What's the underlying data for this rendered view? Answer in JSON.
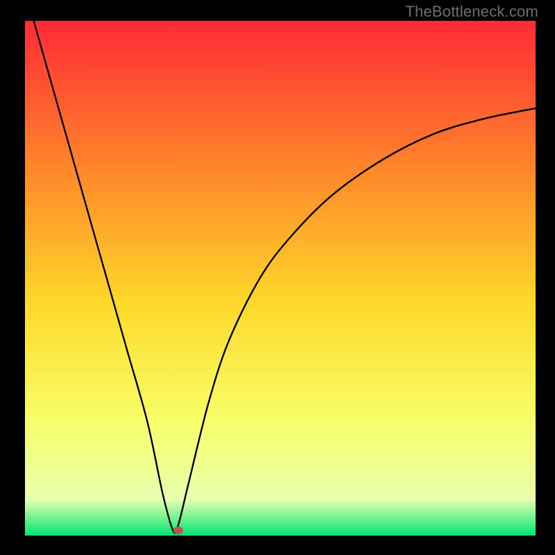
{
  "watermark": "TheBottleneck.com",
  "chart_data": {
    "type": "line",
    "title": "",
    "xlabel": "",
    "ylabel": "",
    "xlim": [
      0,
      100
    ],
    "ylim": [
      0,
      100
    ],
    "gradient_colors": {
      "top": "#ff2a36",
      "upper_mid": "#ff8a2a",
      "mid": "#ffd92a",
      "lower_mid": "#f7ff6a",
      "near_bottom": "#e8ffb0",
      "bottom": "#00e671"
    },
    "series": [
      {
        "name": "bottleneck-curve",
        "comment": "V-shaped curve; y is 'distance from optimal' style metric, minimum near x≈29",
        "x": [
          0,
          4,
          8,
          12,
          16,
          20,
          24,
          27,
          29,
          30,
          32,
          36,
          40,
          46,
          52,
          60,
          70,
          80,
          90,
          100
        ],
        "values": [
          106,
          92,
          78,
          64,
          50,
          36,
          22,
          8,
          1,
          2,
          10,
          26,
          38,
          50,
          58,
          66,
          73,
          78,
          81,
          83
        ]
      }
    ],
    "marker": {
      "name": "optimal-point",
      "x": 30,
      "y": 1,
      "color": "#c05050"
    }
  }
}
